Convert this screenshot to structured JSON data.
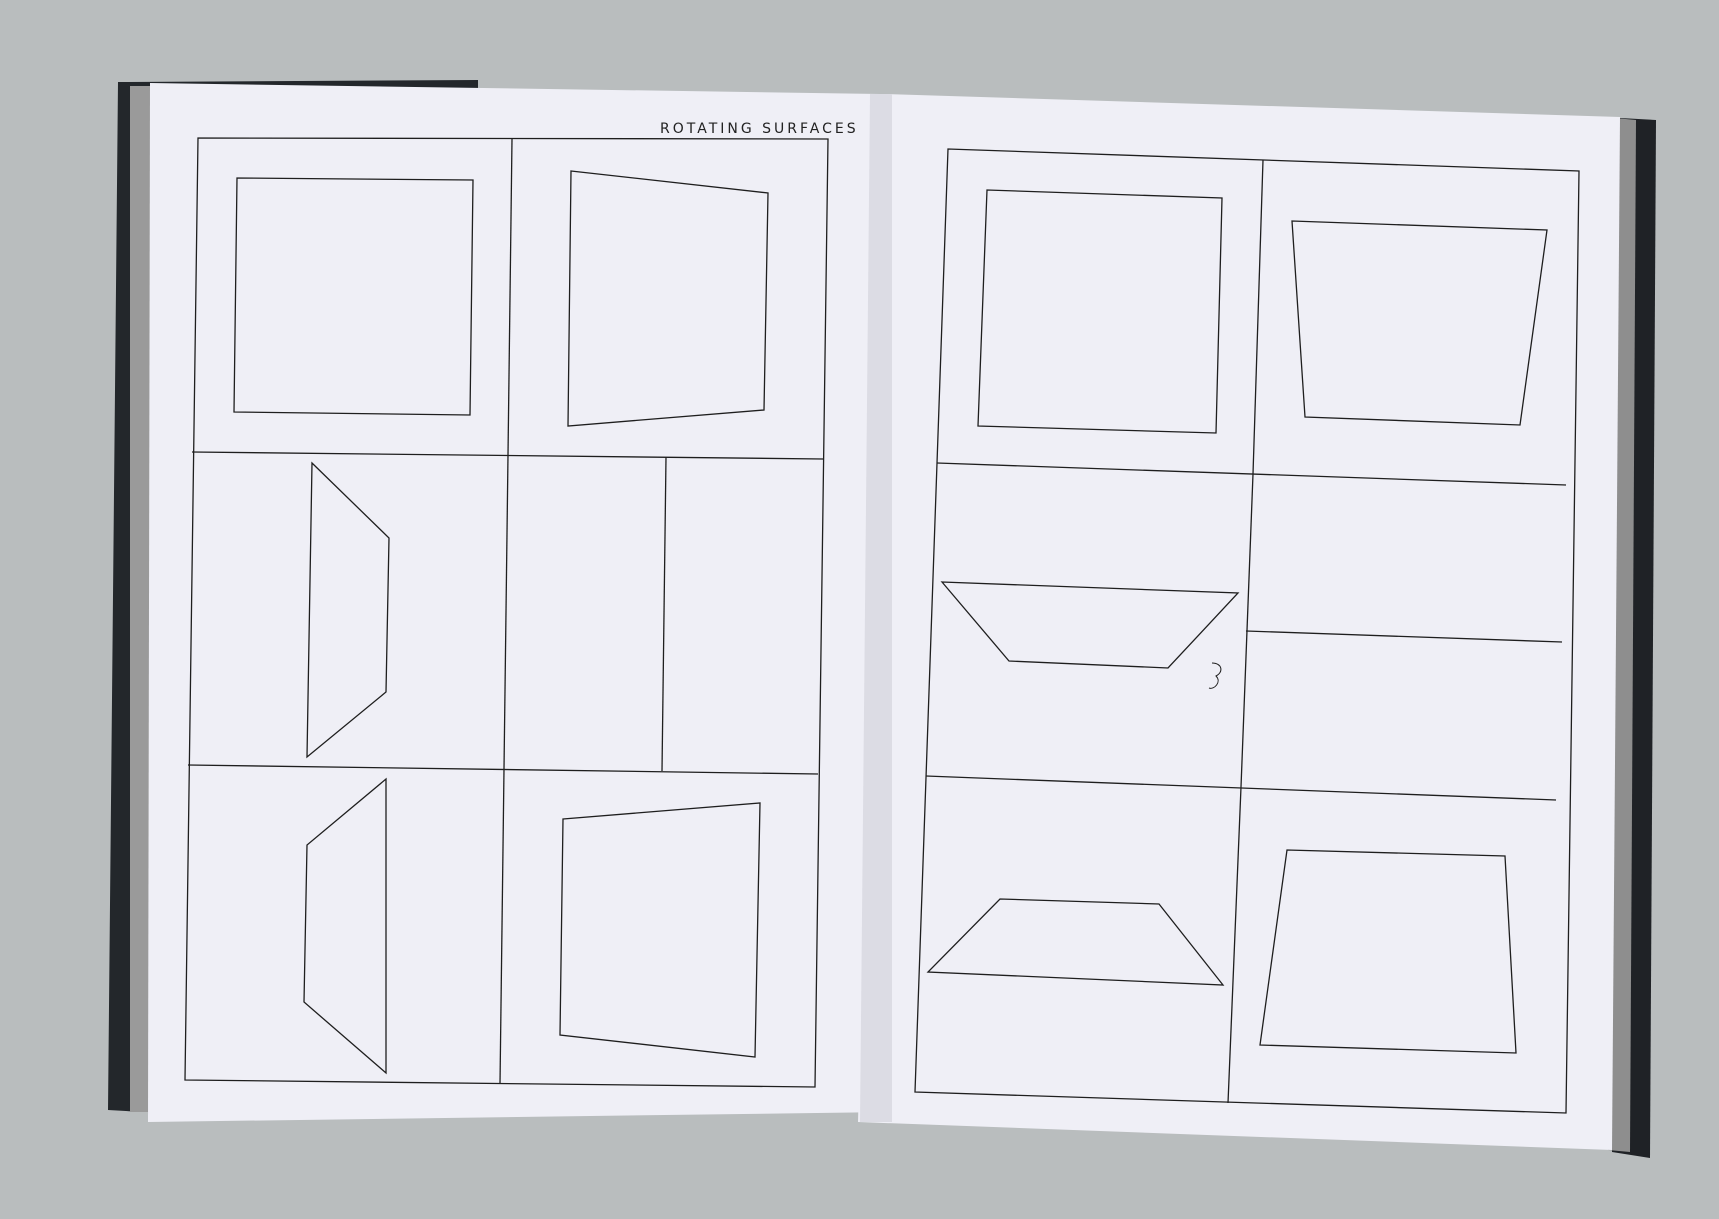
{
  "document": {
    "running_header": "ROTATING SURFACES",
    "spread_pages": [
      "left-page",
      "right-page"
    ]
  },
  "colors": {
    "background": "#b9bdbe",
    "paper": "#efeff6",
    "ink": "#1e1e1e",
    "cover": "#23272b"
  }
}
